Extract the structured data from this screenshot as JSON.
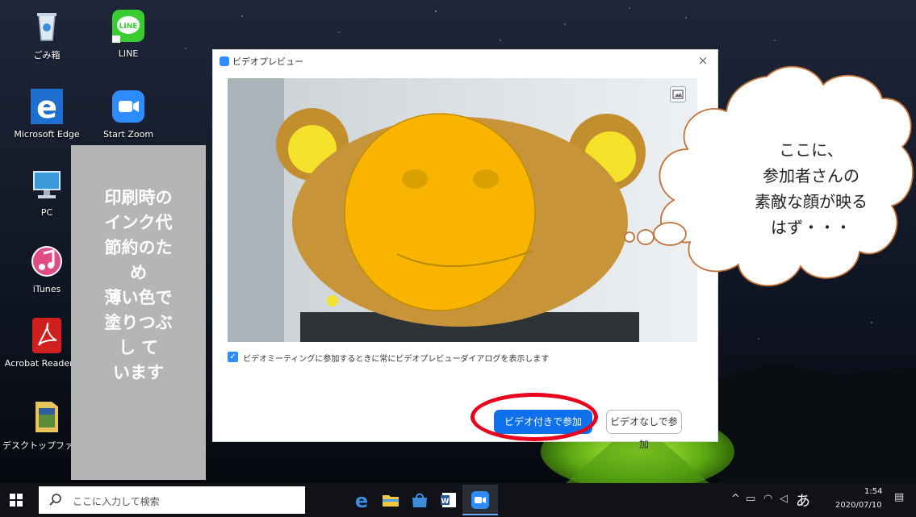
{
  "desktop": {
    "icons": [
      {
        "label": "ごみ箱",
        "icon": "recycle-bin-icon"
      },
      {
        "label": "LINE",
        "icon": "line-icon"
      },
      {
        "label": "Microsoft Edge",
        "icon": "edge-icon"
      },
      {
        "label": "Start Zoom",
        "icon": "zoom-icon"
      },
      {
        "label": "PC",
        "icon": "pc-icon"
      },
      {
        "label": "iTunes",
        "icon": "itunes-icon"
      },
      {
        "label": "Acrobat Reader DC",
        "icon": "acrobat-icon"
      },
      {
        "label": "デスクトップファイル",
        "icon": "folder-icon"
      }
    ],
    "line_badge": "LINE"
  },
  "ink_note": {
    "lines": [
      "印刷時の",
      "インク代",
      "節約のた",
      "め",
      "薄い色で",
      "塗りつぶ",
      "し て",
      "います"
    ]
  },
  "dialog": {
    "title": "ビデオプレビュー",
    "close": "×",
    "checkbox_label": "ビデオミーティングに参加するときに常にビデオプレビューダイアログを表示します",
    "checkbox_checked": true,
    "join_with_video": "ビデオ付きで参加",
    "join_without_video": "ビデオなしで参加"
  },
  "thought_bubble": {
    "lines": [
      "ここに、",
      "参加者さんの",
      "素敵な顔が映る",
      "はず・・・"
    ]
  },
  "taskbar": {
    "search_placeholder": "ここに入力して検索",
    "tray_ime": "あ",
    "time": "1:54",
    "date": "2020/07/10"
  },
  "colors": {
    "zoom_blue": "#0e71eb",
    "highlight_red": "#e8001c",
    "smiley_fill": "#f9b400",
    "note_gray": "#b5b5b5"
  }
}
